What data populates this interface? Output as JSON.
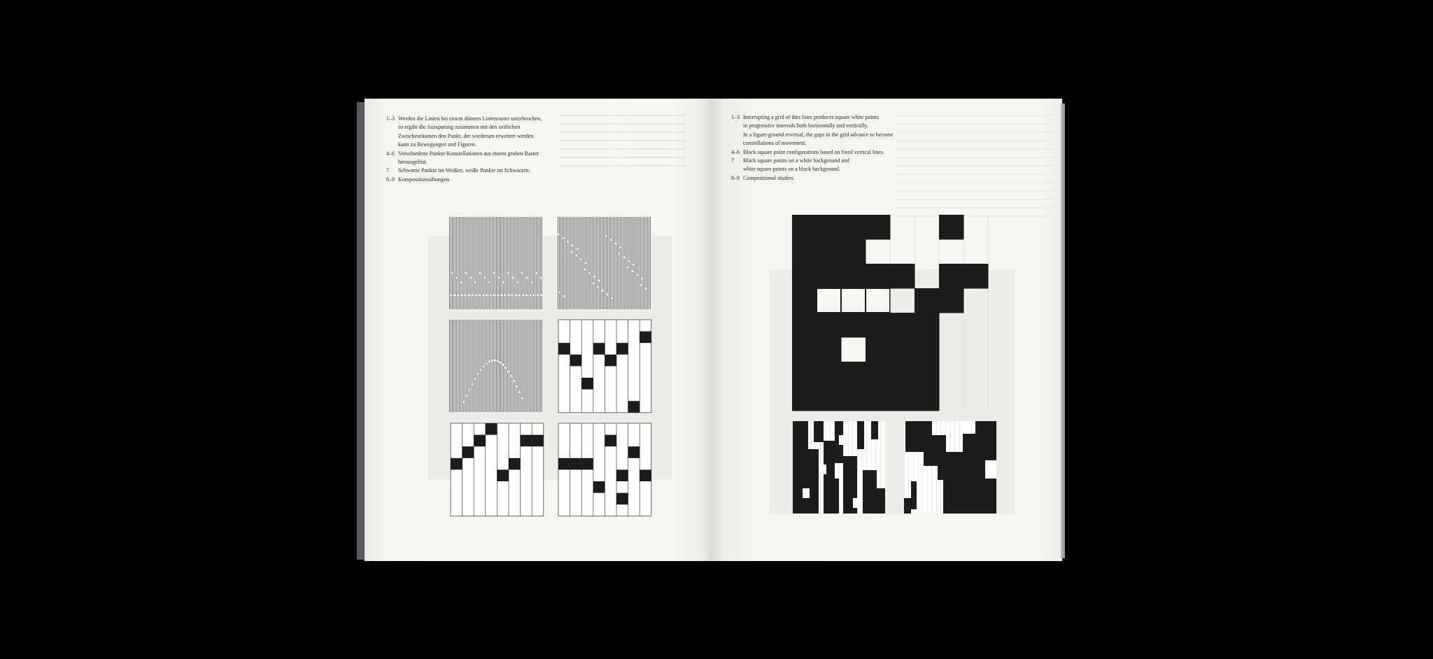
{
  "left_page": {
    "captions": [
      {
        "num": "1–3",
        "lines": [
          "Werden die Linien bei einem dünnen Linienraster unterbrochen,",
          "so ergibt die Aussparung zusammen mit den seitlichen",
          "Zwischenräumen den Punkt, der wiederum erweitert werden",
          "kann zu Bewegungen und Figuren."
        ]
      },
      {
        "num": "4–6",
        "lines": [
          "Verschiedene Punkte-Konstellationen aus einem groben Raster",
          "herausgelöst."
        ]
      },
      {
        "num": "7",
        "lines": [
          "Schwarze Punkte im Weißen, weiße Punkte im Schwarzen."
        ]
      },
      {
        "num": "8–9",
        "lines": [
          "Kompositionsübungen."
        ]
      }
    ]
  },
  "right_page": {
    "captions": [
      {
        "num": "1–3",
        "lines": [
          "Interrupting a grid of thin lines produces square white points",
          "in progressive intervals both horizontally and vertically.",
          "In a figure-ground reversal, the gaps in the grid advance to become",
          "constellations of movement."
        ]
      },
      {
        "num": "4–6",
        "lines": [
          "Black square point configurations based on fixed vertical lines."
        ]
      },
      {
        "num": "7",
        "lines": [
          "Black square points on a white background and",
          "white square points on a black background."
        ]
      },
      {
        "num": "8–9",
        "lines": [
          "Compositional studies."
        ]
      }
    ]
  },
  "colors": {
    "background": "#000000",
    "paper": "#f6f6f4",
    "ink": "#1c1c1c"
  }
}
